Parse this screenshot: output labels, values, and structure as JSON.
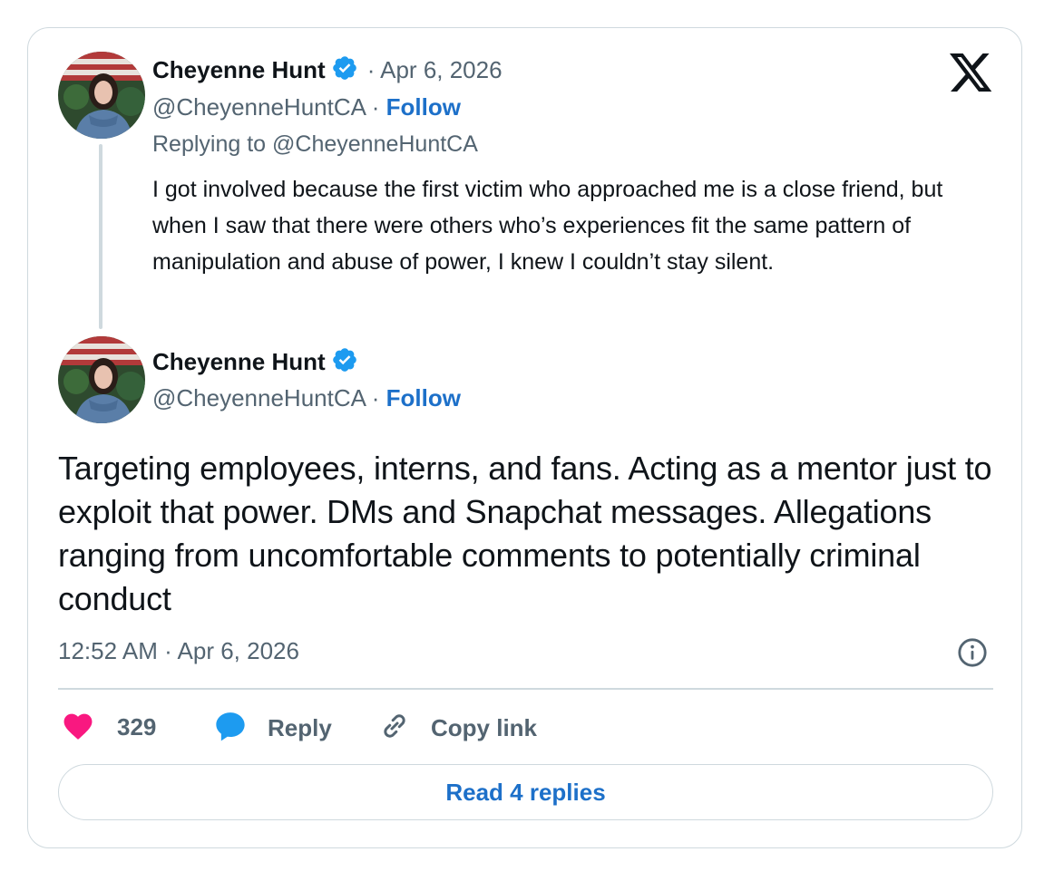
{
  "parent_tweet": {
    "author_name": "Cheyenne Hunt",
    "date": "· Apr 6, 2026",
    "handle": "@CheyenneHuntCA",
    "handle_sep": " · ",
    "follow_label": "Follow",
    "replying_to": "Replying to @CheyenneHuntCA",
    "text": "I got involved because the first victim who approached me is a close friend, but when I saw that there were others who’s experiences fit the same pattern of manipulation and abuse of power, I knew I couldn’t stay silent."
  },
  "main_tweet": {
    "author_name": "Cheyenne Hunt",
    "handle": "@CheyenneHuntCA",
    "handle_sep": " · ",
    "follow_label": "Follow",
    "text": "Targeting employees, interns, and fans. Acting as a mentor just to exploit that power. DMs and Snapchat messages. Allegations ranging from uncomfortable comments to potentially criminal conduct",
    "timestamp": "12:52 AM · Apr 6, 2026"
  },
  "actions": {
    "likes_count": "329",
    "reply_label": "Reply",
    "copy_link_label": "Copy link"
  },
  "read_replies_label": "Read 4 replies",
  "icons": {
    "logo": "x-logo-icon",
    "verified": "verified-badge-icon",
    "info": "info-icon",
    "heart": "heart-icon",
    "reply": "reply-bubble-icon",
    "link": "link-icon"
  },
  "colors": {
    "accent": "#1d70c9",
    "verified": "#1d9bf0",
    "heart": "#f91880",
    "muted": "#536471",
    "border": "#cfd9de"
  }
}
